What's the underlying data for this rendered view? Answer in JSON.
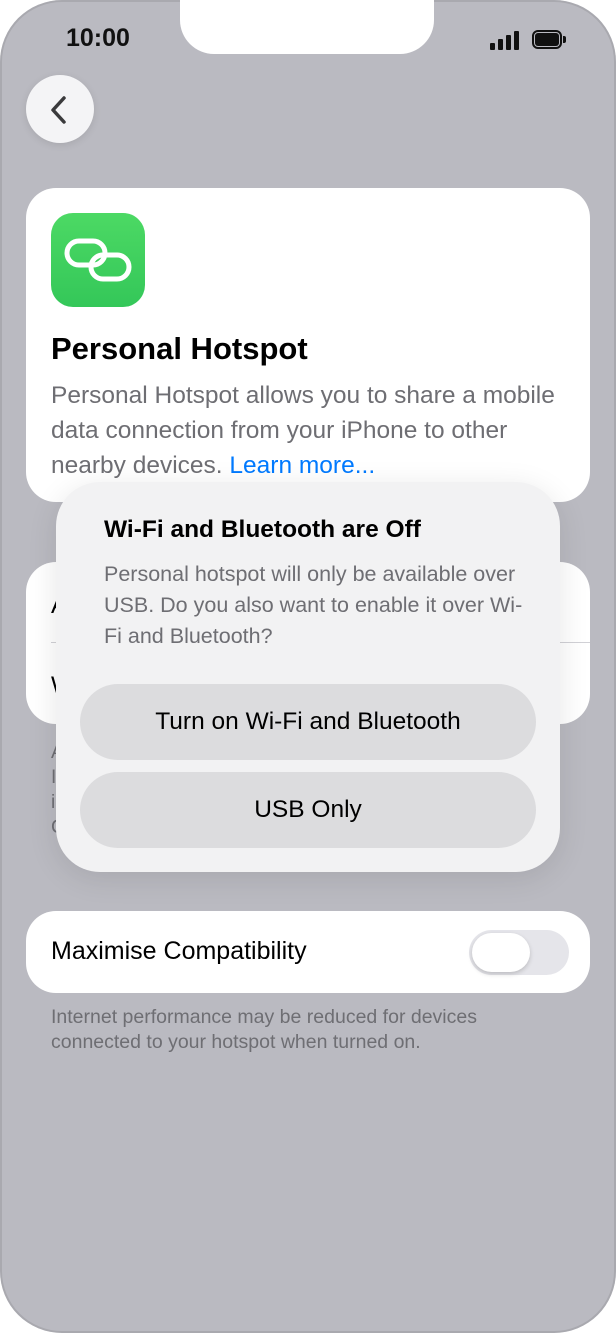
{
  "status_bar": {
    "time": "10:00"
  },
  "hero": {
    "icon": "link-icon",
    "title": "Personal Hotspot",
    "description": "Personal Hotspot allows you to share a mobile data connection from your iPhone to other nearby devices.",
    "link_text": "Learn more..."
  },
  "settings": {
    "row1_label": "A",
    "row2_label": "W",
    "footnote_left": "A\nI\ni\nC"
  },
  "compatibility": {
    "label": "Maximise Compatibility",
    "toggle_on": false,
    "note": "Internet performance may be reduced for devices connected to your hotspot when turned on."
  },
  "alert": {
    "title": "Wi-Fi and Bluetooth are Off",
    "message": "Personal hotspot will only be available over USB. Do you also want to enable it over Wi-Fi and Bluetooth?",
    "buttons": [
      {
        "label": "Turn on Wi-Fi and Bluetooth"
      },
      {
        "label": "USB Only"
      }
    ]
  },
  "colors": {
    "accent": "#007aff",
    "icon_green": "#34c759"
  }
}
